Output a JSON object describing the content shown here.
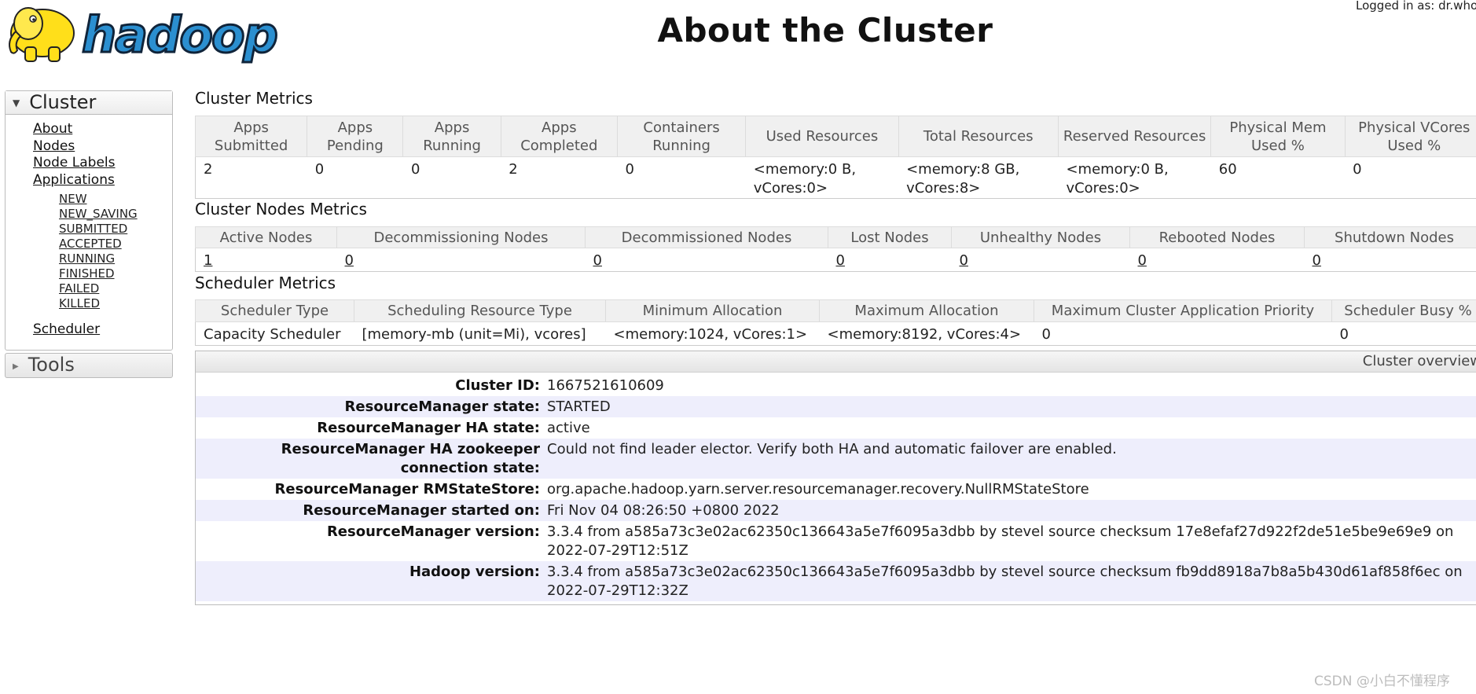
{
  "header": {
    "logo_text": "hadoop",
    "title": "About the Cluster",
    "logged_in": "Logged in as: dr.who"
  },
  "sidebar": {
    "cluster_label": "Cluster",
    "links": [
      "About",
      "Nodes",
      "Node Labels",
      "Applications"
    ],
    "app_states": [
      "NEW",
      "NEW_SAVING",
      "SUBMITTED",
      "ACCEPTED",
      "RUNNING",
      "FINISHED",
      "FAILED",
      "KILLED"
    ],
    "scheduler": "Scheduler",
    "tools_label": "Tools"
  },
  "cluster_metrics": {
    "title": "Cluster Metrics",
    "headers": [
      [
        "Apps",
        "Submitted"
      ],
      [
        "Apps",
        "Pending"
      ],
      [
        "Apps",
        "Running"
      ],
      [
        "Apps",
        "Completed"
      ],
      [
        "Containers",
        "Running"
      ],
      [
        "Used Resources"
      ],
      [
        "Total Resources"
      ],
      [
        "Reserved Resources"
      ],
      [
        "Physical Mem",
        "Used %"
      ],
      [
        "Physical VCores",
        "Used %"
      ]
    ],
    "values": [
      [
        "2"
      ],
      [
        "0"
      ],
      [
        "0"
      ],
      [
        "2"
      ],
      [
        "0"
      ],
      [
        "<memory:0 B,",
        "vCores:0>"
      ],
      [
        "<memory:8 GB,",
        "vCores:8>"
      ],
      [
        "<memory:0 B,",
        "vCores:0>"
      ],
      [
        "60"
      ],
      [
        "0"
      ]
    ]
  },
  "nodes_metrics": {
    "title": "Cluster Nodes Metrics",
    "headers": [
      "Active Nodes",
      "Decommissioning Nodes",
      "Decommissioned Nodes",
      "Lost Nodes",
      "Unhealthy Nodes",
      "Rebooted Nodes",
      "Shutdown Nodes"
    ],
    "values": [
      "1",
      "0",
      "0",
      "0",
      "0",
      "0",
      "0"
    ]
  },
  "scheduler_metrics": {
    "title": "Scheduler Metrics",
    "headers": [
      "Scheduler Type",
      "Scheduling Resource Type",
      "Minimum Allocation",
      "Maximum Allocation",
      "Maximum Cluster Application Priority",
      "Scheduler Busy %"
    ],
    "values": [
      "Capacity Scheduler",
      "[memory-mb (unit=Mi), vcores]",
      "<memory:1024, vCores:1>",
      "<memory:8192, vCores:4>",
      "0",
      "0"
    ]
  },
  "overview": {
    "title": "Cluster overview",
    "rows": [
      {
        "label": "Cluster ID:",
        "value": "1667521610609"
      },
      {
        "label": "ResourceManager state:",
        "value": "STARTED"
      },
      {
        "label": "ResourceManager HA state:",
        "value": "active"
      },
      {
        "label": "ResourceManager HA zookeeper connection state:",
        "value": "Could not find leader elector. Verify both HA and automatic failover are enabled."
      },
      {
        "label": "ResourceManager RMStateStore:",
        "value": "org.apache.hadoop.yarn.server.resourcemanager.recovery.NullRMStateStore"
      },
      {
        "label": "ResourceManager started on:",
        "value": "Fri Nov 04 08:26:50 +0800 2022"
      },
      {
        "label": "ResourceManager version:",
        "value": "3.3.4 from a585a73c3e02ac62350c136643a5e7f6095a3dbb by stevel source checksum 17e8efaf27d922f2de51e5be9e69e9 on 2022-07-29T12:51Z"
      },
      {
        "label": "Hadoop version:",
        "value": "3.3.4 from a585a73c3e02ac62350c136643a5e7f6095a3dbb by stevel source checksum fb9dd8918a7b8a5b430d61af858f6ec on 2022-07-29T12:32Z"
      }
    ]
  },
  "watermark": "CSDN @小白不懂程序",
  "colors": {
    "row_alt": "#eeeefc",
    "header_bg": "#f0f0f0",
    "logo_blue": "#1d5d8c",
    "elephant_yellow": "#ffdf1a"
  },
  "icons": [
    "hadoop-elephant-logo",
    "expand-triangle-icon",
    "collapsed-triangle-icon"
  ]
}
